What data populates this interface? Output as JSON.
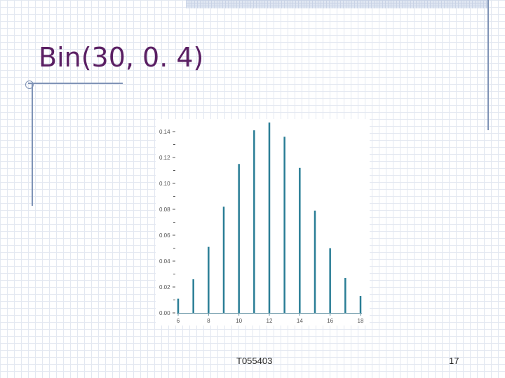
{
  "slide": {
    "title": "Bin(30, 0. 4)",
    "footer_center": "T055403",
    "footer_right": "17"
  },
  "colors": {
    "title": "#5a1f63",
    "bar": "#2a7e96",
    "axis": "#5f8fa0",
    "accent_rule": "#7f93b6"
  },
  "chart_data": {
    "type": "bar",
    "title": "",
    "xlabel": "",
    "ylabel": "",
    "x": [
      6,
      7,
      8,
      9,
      10,
      11,
      12,
      13,
      14,
      15,
      16,
      17,
      18
    ],
    "values": [
      0.011,
      0.026,
      0.051,
      0.082,
      0.115,
      0.141,
      0.147,
      0.136,
      0.112,
      0.079,
      0.05,
      0.027,
      0.013
    ],
    "xlim": [
      6,
      18
    ],
    "ylim": [
      0,
      0.14
    ],
    "xticks": [
      6,
      8,
      10,
      12,
      14,
      16,
      18
    ],
    "xtick_labels": [
      "6",
      "8",
      "10",
      "12",
      "14",
      "16",
      "18"
    ],
    "yticks": [
      0,
      0.02,
      0.04,
      0.06,
      0.08,
      0.1,
      0.12,
      0.14
    ],
    "ytick_labels": [
      "0.00",
      "0.02",
      "0.04",
      "0.06",
      "0.08",
      "0.10",
      "0.12",
      "0.14"
    ],
    "grid": false,
    "legend": false
  }
}
